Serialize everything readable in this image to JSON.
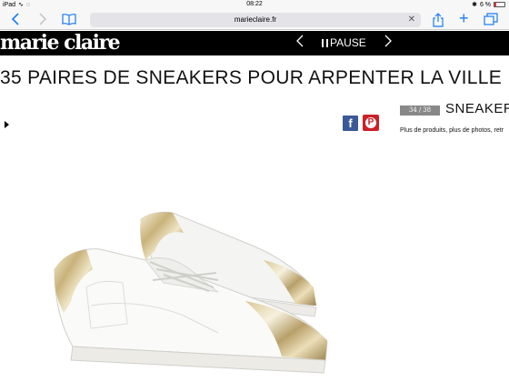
{
  "status": {
    "device": "iPad",
    "time": "08:22",
    "battery": "6 %"
  },
  "browser": {
    "url": "marieclaire.fr"
  },
  "site": {
    "logo": "marie claire",
    "slideshow_control": "PAUSE"
  },
  "article": {
    "headline": "35 PAIRES DE SNEAKERS POUR ARPENTER LA VILLE"
  },
  "slide": {
    "current": "34",
    "total": "38",
    "title": "SNEAKER",
    "subtitle": "Plus de produits, plus de photos, retr"
  },
  "share": {
    "facebook_glyph": "f",
    "pinterest_glyph": "P"
  },
  "colors": {
    "facebook": "#3b5998",
    "pinterest": "#cb2027",
    "ios_accent": "#1a7cf4"
  }
}
